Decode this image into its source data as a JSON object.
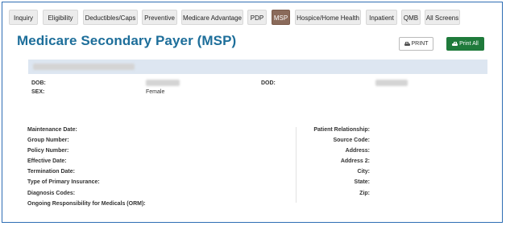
{
  "tabs": [
    {
      "label": "Inquiry",
      "active": false
    },
    {
      "label": "Eligibility",
      "active": false
    },
    {
      "label": "Deductibles/Caps",
      "active": false
    },
    {
      "label": "Preventive",
      "active": false
    },
    {
      "label": "Medicare Advantage",
      "active": false
    },
    {
      "label": "PDP",
      "active": false
    },
    {
      "label": "MSP",
      "active": true
    },
    {
      "label": "Hospice/Home Health",
      "active": false
    },
    {
      "label": "Inpatient",
      "active": false
    },
    {
      "label": "QMB",
      "active": false
    },
    {
      "label": "All Screens",
      "active": false
    }
  ],
  "page": {
    "title": "Medicare Secondary Payer (MSP)",
    "print_label": "PRINT",
    "print_all_label": "Print All",
    "print_icon": "printer-icon",
    "accent_color": "#1d6e9a",
    "print_all_color": "#1f7a3b"
  },
  "demographics": {
    "dob_label": "DOB:",
    "sex_label": "SEX:",
    "sex_value": "Female",
    "dod_label": "DOD:"
  },
  "msp_left": [
    "Maintenance Date:",
    "Group Number:",
    "Policy Number:",
    "Effective Date:",
    "Termination Date:",
    "Type of Primary Insurance:",
    "Diagnosis Codes:",
    "Ongoing Responsibility for Medicals (ORM):"
  ],
  "msp_right": [
    "Patient Relationship:",
    "Source Code:",
    "Address:",
    "Address 2:",
    "City:",
    "State:",
    "Zip:"
  ]
}
